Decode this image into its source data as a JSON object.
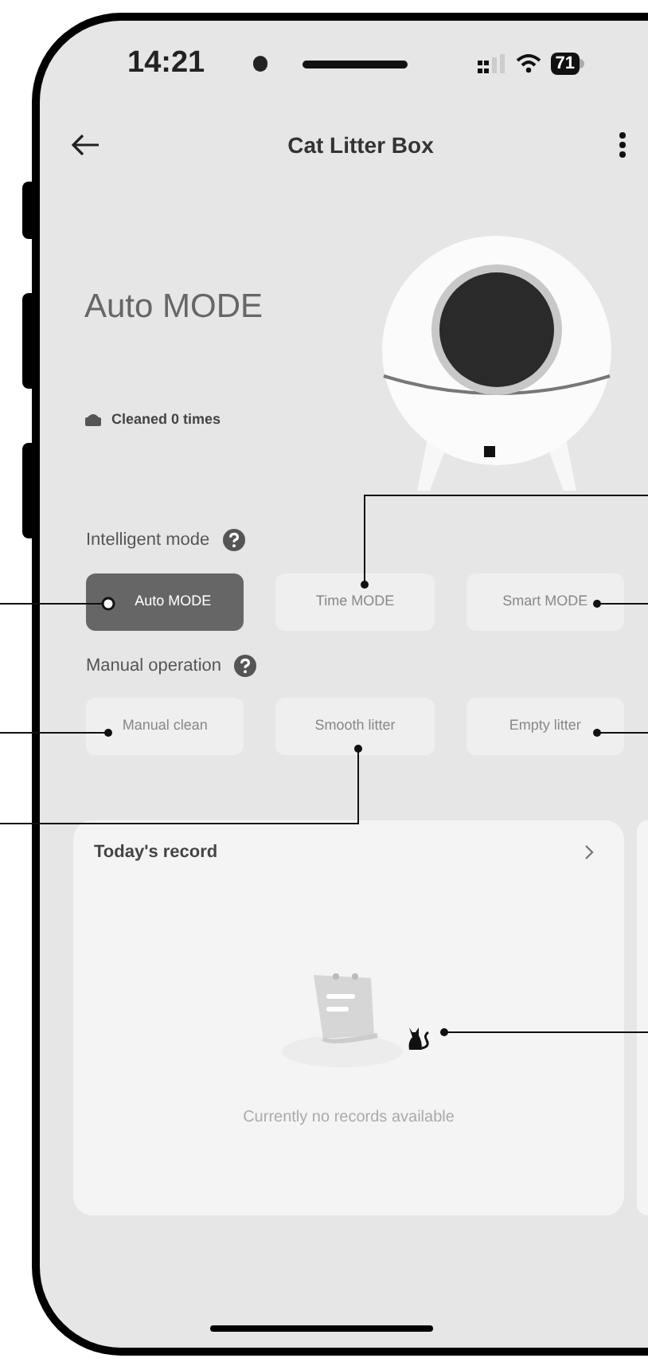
{
  "status_bar": {
    "time": "14:21",
    "battery": "71"
  },
  "nav": {
    "title": "Cat Litter Box"
  },
  "device": {
    "mode": "Auto MODE",
    "cleaned_label": "Cleaned",
    "cleaned_count": "0",
    "cleaned_unit": "times"
  },
  "intelligent_mode": {
    "label": "Intelligent mode",
    "options": [
      {
        "label": "Auto MODE",
        "selected": true
      },
      {
        "label": "Time MODE",
        "selected": false
      },
      {
        "label": "Smart MODE",
        "selected": false
      }
    ]
  },
  "manual_operation": {
    "label": "Manual operation",
    "actions": [
      {
        "label": "Manual clean"
      },
      {
        "label": "Smooth litter"
      },
      {
        "label": "Empty litter"
      }
    ]
  },
  "record_card": {
    "title": "Today's record",
    "empty_text": "Currently no records available"
  }
}
